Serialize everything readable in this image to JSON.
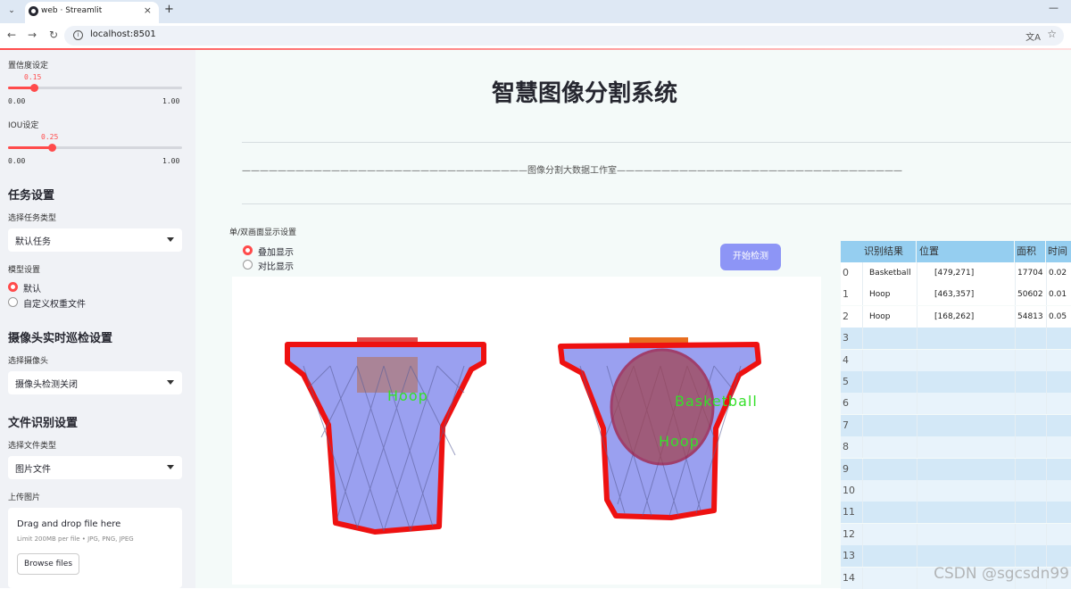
{
  "browser": {
    "tab_title": "web · Streamlit",
    "tab_close": "×",
    "new_tab": "+",
    "url": "localhost:8501"
  },
  "sidebar": {
    "confidence": {
      "label": "置信度设定",
      "value": "0.15",
      "value_fraction": 0.15,
      "min": "0.00",
      "max": "1.00"
    },
    "iou": {
      "label": "IOU设定",
      "value": "0.25",
      "value_fraction": 0.25,
      "min": "0.00",
      "max": "1.00"
    },
    "task_section": "任务设置",
    "task_type_label": "选择任务类型",
    "task_type_value": "默认任务",
    "model_label": "模型设置",
    "model_options": [
      "默认",
      "自定义权重文件"
    ],
    "camera_section": "摄像头实时巡检设置",
    "camera_label": "选择摄像头",
    "camera_value": "摄像头检测关闭",
    "file_section": "文件识别设置",
    "file_type_label": "选择文件类型",
    "file_type_value": "图片文件",
    "upload_label": "上传图片",
    "upload": {
      "title": "Drag and drop file here",
      "limit": "Limit 200MB per file • JPG, PNG, JPEG",
      "browse": "Browse files"
    }
  },
  "main": {
    "title": "智慧图像分割系统",
    "subtitle": "————————————————————————————————图像分割大数据工作室————————————————————————————————",
    "display_label": "单/双画面显示设置",
    "display_options": [
      "叠加显示",
      "对比显示"
    ],
    "detect_button": "开始检测",
    "detections": [
      "Hoop",
      "Basketball",
      "Hoop"
    ]
  },
  "table": {
    "headers": [
      "",
      "识别结果",
      "位置",
      "面积",
      "时间"
    ],
    "rows": [
      [
        "0",
        "Basketball",
        "[479,271]",
        "17704",
        "0.02"
      ],
      [
        "1",
        "Hoop",
        "[463,357]",
        "50602",
        "0.01"
      ],
      [
        "2",
        "Hoop",
        "[168,262]",
        "54813",
        "0.05"
      ],
      [
        "3",
        "",
        "",
        "",
        ""
      ],
      [
        "4",
        "",
        "",
        "",
        ""
      ],
      [
        "5",
        "",
        "",
        "",
        ""
      ],
      [
        "6",
        "",
        "",
        "",
        ""
      ],
      [
        "7",
        "",
        "",
        "",
        ""
      ],
      [
        "8",
        "",
        "",
        "",
        ""
      ],
      [
        "9",
        "",
        "",
        "",
        ""
      ],
      [
        "10",
        "",
        "",
        "",
        ""
      ],
      [
        "11",
        "",
        "",
        "",
        ""
      ],
      [
        "12",
        "",
        "",
        "",
        ""
      ],
      [
        "13",
        "",
        "",
        "",
        ""
      ],
      [
        "14",
        "",
        "",
        "",
        ""
      ]
    ]
  },
  "watermark": "CSDN @sgcsdn99",
  "colors": {
    "accent": "#ff4b4b",
    "button": "#8d95f6",
    "mask": "#9aa0f0",
    "outline": "#ee1111",
    "label": "#35e02a",
    "table_header": "#95cef0",
    "table_stripe": "#d3e8f7"
  }
}
